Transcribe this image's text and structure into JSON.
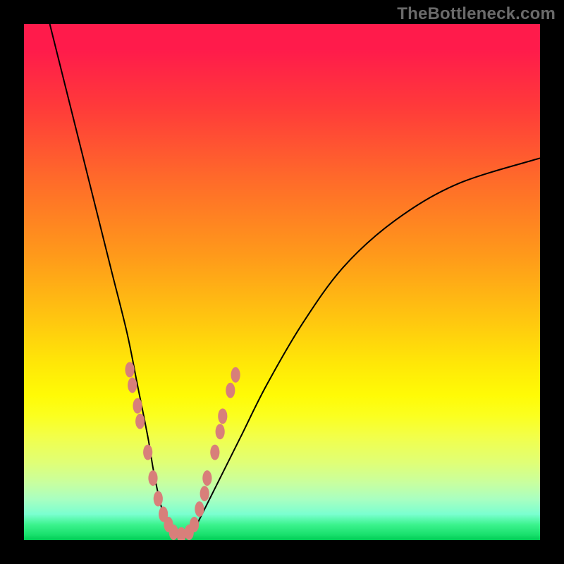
{
  "watermark": "TheBottleneck.com",
  "colors": {
    "background": "#000000",
    "curve": "#000000",
    "beads": "#d87f7a",
    "gradient_stops": [
      "#ff1b4b",
      "#ff3a3a",
      "#ff6a2a",
      "#ff9a1a",
      "#ffc90f",
      "#ffe807",
      "#fffb06",
      "#f2ff4a",
      "#c8ffa0",
      "#7affd0",
      "#18e06c",
      "#00cc55"
    ]
  },
  "chart_data": {
    "type": "line",
    "title": "",
    "xlabel": "",
    "ylabel": "",
    "xlim": [
      0,
      100
    ],
    "ylim": [
      0,
      100
    ],
    "note": "x is horizontal % across plot, y is bottleneck % (0 = bottom/green, 100 = top/red). Curve is a V with minimum ~x=30.",
    "series": [
      {
        "name": "left_branch",
        "x": [
          5,
          8,
          11,
          14,
          17,
          20,
          22,
          24,
          25,
          26,
          27,
          28
        ],
        "values": [
          100,
          88,
          76,
          64,
          52,
          40,
          30,
          20,
          14,
          9,
          5,
          2
        ]
      },
      {
        "name": "bottom",
        "x": [
          28,
          29,
          30,
          31,
          32,
          33
        ],
        "values": [
          2,
          1,
          0.5,
          0.5,
          1,
          2
        ]
      },
      {
        "name": "right_branch",
        "x": [
          33,
          35,
          38,
          42,
          47,
          54,
          62,
          72,
          84,
          100
        ],
        "values": [
          2,
          6,
          12,
          20,
          30,
          42,
          53,
          62,
          69,
          74
        ]
      }
    ],
    "beads": {
      "name": "highlighted_points",
      "points": [
        {
          "x": 20.5,
          "y": 33
        },
        {
          "x": 21.0,
          "y": 30
        },
        {
          "x": 22.0,
          "y": 26
        },
        {
          "x": 22.5,
          "y": 23
        },
        {
          "x": 24.0,
          "y": 17
        },
        {
          "x": 25.0,
          "y": 12
        },
        {
          "x": 26.0,
          "y": 8
        },
        {
          "x": 27.0,
          "y": 5
        },
        {
          "x": 28.0,
          "y": 3
        },
        {
          "x": 29.0,
          "y": 1.5
        },
        {
          "x": 30.5,
          "y": 1
        },
        {
          "x": 32.0,
          "y": 1.5
        },
        {
          "x": 33.0,
          "y": 3
        },
        {
          "x": 34.0,
          "y": 6
        },
        {
          "x": 35.0,
          "y": 9
        },
        {
          "x": 35.5,
          "y": 12
        },
        {
          "x": 37.0,
          "y": 17
        },
        {
          "x": 38.0,
          "y": 21
        },
        {
          "x": 38.5,
          "y": 24
        },
        {
          "x": 40.0,
          "y": 29
        },
        {
          "x": 41.0,
          "y": 32
        }
      ],
      "radius_pct": 1.2
    }
  }
}
